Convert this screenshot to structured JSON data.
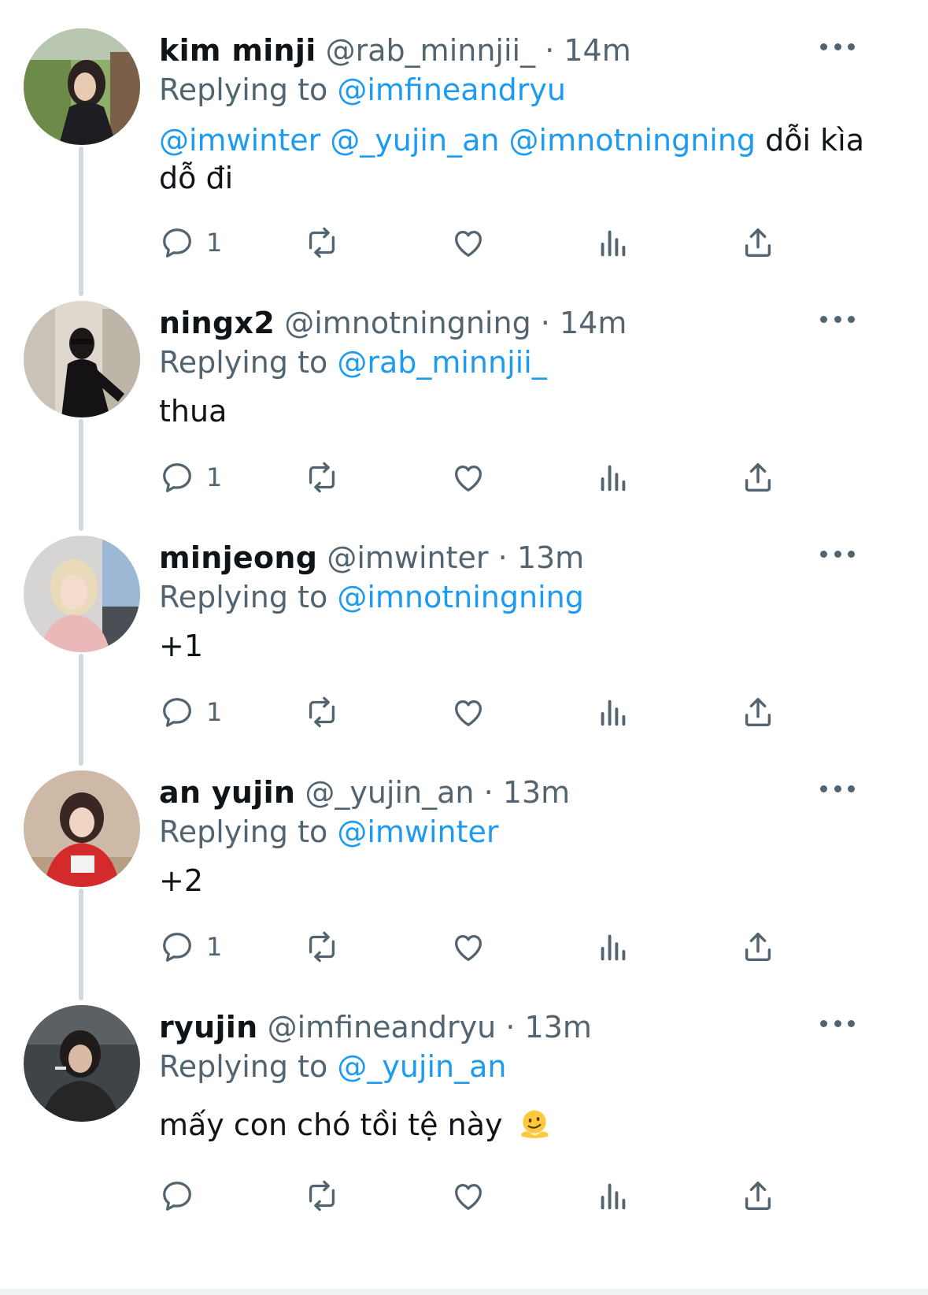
{
  "tweets": [
    {
      "name": "kim minji",
      "handle": "@rab_minnjii_",
      "separator": "·",
      "time": "14m",
      "replying_prefix": "Replying to",
      "replying_to": "@imfineandryu",
      "body_mentions": [
        "@imwinter",
        "@_yujin_an",
        "@imnotningning"
      ],
      "body_line1_tail": "dỗi kìa",
      "body_line2": "dỗ đi",
      "reply_count": "1"
    },
    {
      "name": "ningx2",
      "handle": "@imnotningning",
      "separator": "·",
      "time": "14m",
      "replying_prefix": "Replying to",
      "replying_to": "@rab_minnjii_",
      "body": "thua",
      "reply_count": "1"
    },
    {
      "name": "minjeong",
      "handle": "@imwinter",
      "separator": "·",
      "time": "13m",
      "replying_prefix": "Replying to",
      "replying_to": "@imnotningning",
      "body": "+1",
      "reply_count": "1"
    },
    {
      "name": "an yujin",
      "handle": "@_yujin_an",
      "separator": "·",
      "time": "13m",
      "replying_prefix": "Replying to",
      "replying_to": "@imwinter",
      "body": "+2",
      "reply_count": "1"
    },
    {
      "name": "ryujin",
      "handle": "@imfineandryu",
      "separator": "·",
      "time": "13m",
      "replying_prefix": "Replying to",
      "replying_to": "@_yujin_an",
      "body": "mấy con chó tồi tệ này",
      "body_emoji": "melting-face-emoji",
      "reply_count": ""
    }
  ],
  "icons": {
    "reply": "reply-icon",
    "retweet": "retweet-icon",
    "like": "heart-icon",
    "views": "views-chart-icon",
    "share": "share-icon",
    "more": "more-dots-icon"
  },
  "colors": {
    "text": "#0f1419",
    "secondary": "#536471",
    "link": "#1d9bf0",
    "thread_line": "#cfd9de"
  }
}
